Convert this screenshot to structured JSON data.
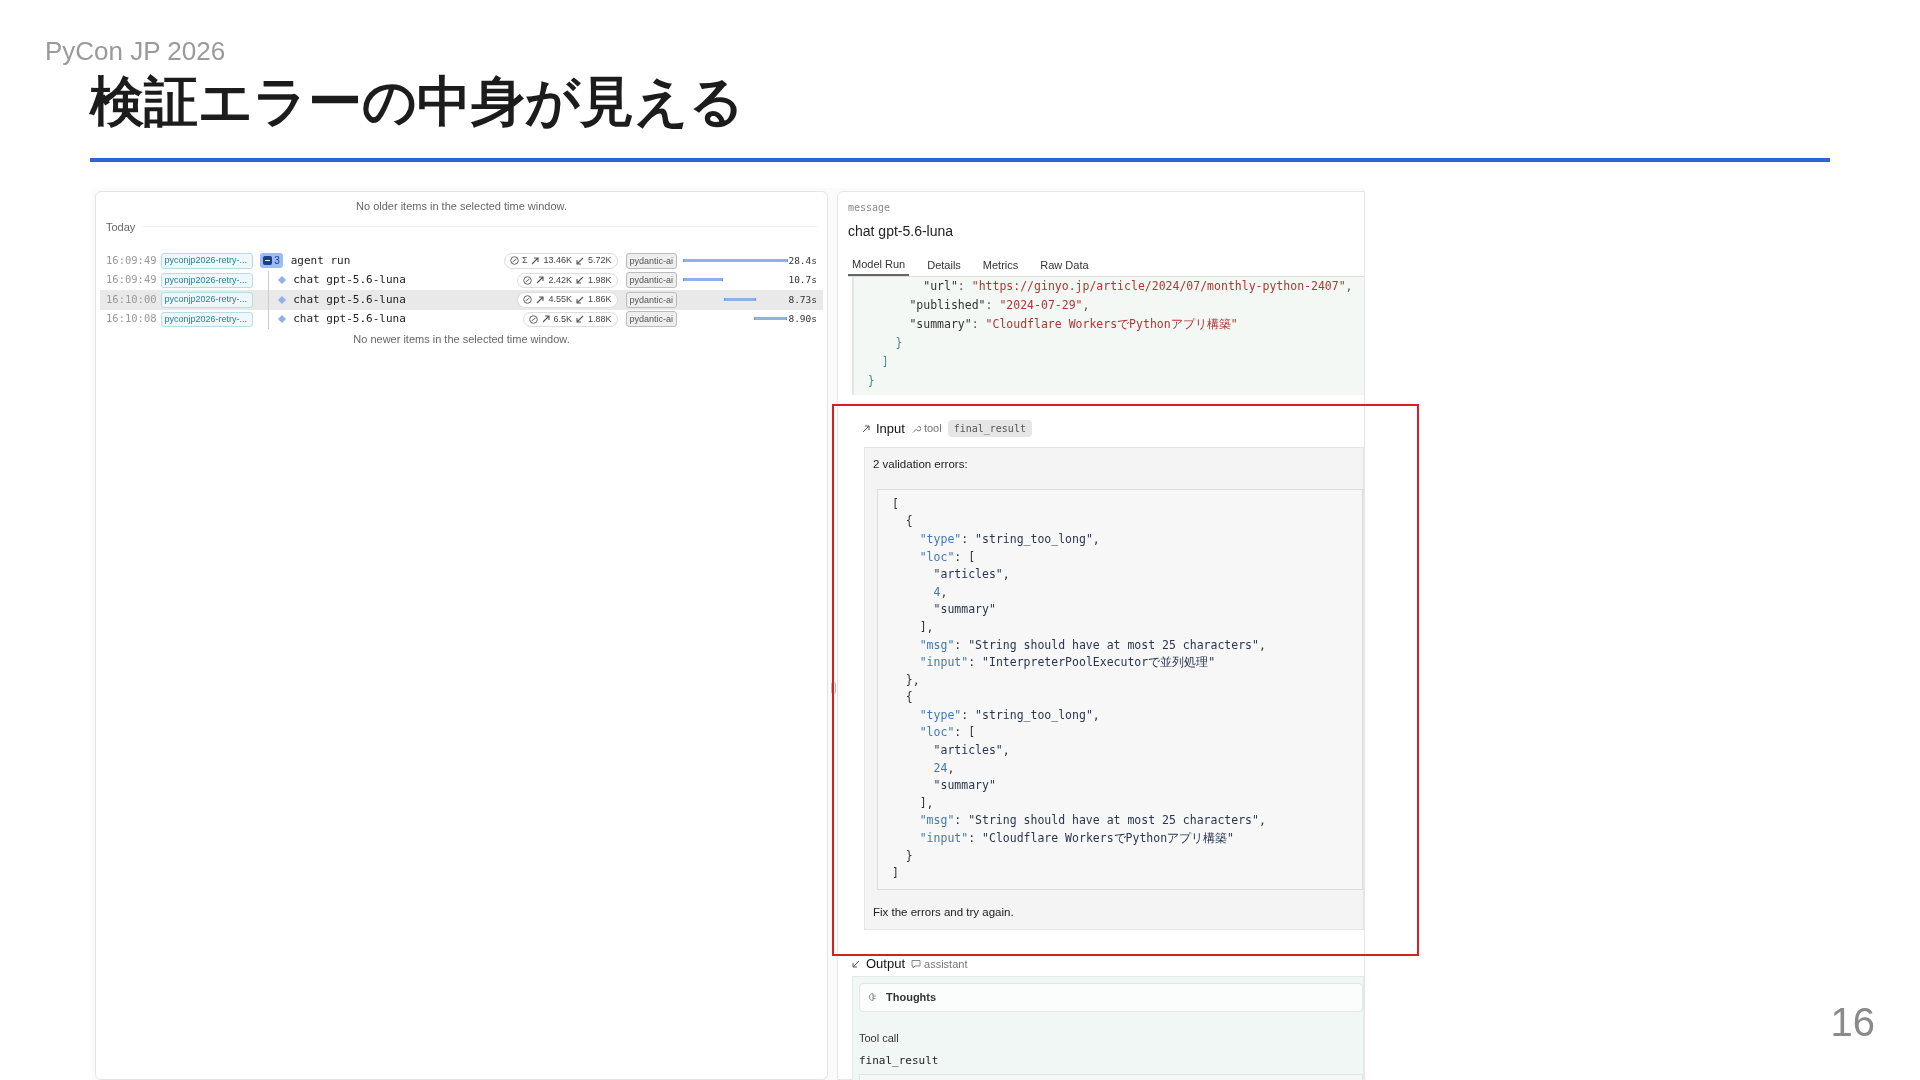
{
  "slide": {
    "conference": "PyCon JP 2026",
    "title": "検証エラーの中身が見える",
    "page_number": "16"
  },
  "trace_list": {
    "older_notice": "No older items in the selected time window.",
    "day_label": "Today",
    "rows": [
      {
        "time": "16:09:49",
        "tag": "pyconjp2026-retry-...",
        "expanded": true,
        "child_count": "3",
        "sum_symbol": "Σ",
        "name": "agent run",
        "tokens_in": "13.46K",
        "tokens_out": "5.72K",
        "service": "pydantic-ai",
        "duration": "28.4s",
        "selected": false,
        "children": [
          {
            "time": "16:09:49",
            "tag": "pyconjp2026-retry-...",
            "name": "chat gpt-5.6-luna",
            "tokens_in": "2.42K",
            "tokens_out": "1.98K",
            "service": "pydantic-ai",
            "duration": "10.7s",
            "selected": false
          },
          {
            "time": "16:10:00",
            "tag": "pyconjp2026-retry-...",
            "name": "chat gpt-5.6-luna",
            "tokens_in": "4.55K",
            "tokens_out": "1.86K",
            "service": "pydantic-ai",
            "duration": "8.73s",
            "selected": true
          },
          {
            "time": "16:10:08",
            "tag": "pyconjp2026-retry-...",
            "name": "chat gpt-5.6-luna",
            "tokens_in": "6.5K",
            "tokens_out": "1.88K",
            "service": "pydantic-ai",
            "duration": "8.90s",
            "selected": false
          }
        ]
      }
    ],
    "newer_notice": "No newer items in the selected time window."
  },
  "detail": {
    "label": "message",
    "title": "chat gpt-5.6-luna",
    "tabs": [
      {
        "label": "Model Run",
        "selected": true
      },
      {
        "label": "Details",
        "selected": false
      },
      {
        "label": "Metrics",
        "selected": false
      },
      {
        "label": "Raw Data",
        "selected": false
      }
    ],
    "previous_code": {
      "kind": "data",
      "lines": [
        [
          {
            "kind": "key",
            "text": "          \"url\""
          },
          {
            "kind": "punct",
            "text": ": "
          },
          {
            "kind": "string",
            "text": "\"https://ginyo.jp/article/2024/07/monthly-python-2407\""
          },
          {
            "kind": "punct",
            "text": ","
          }
        ],
        [
          {
            "kind": "key",
            "text": "        \"published\""
          },
          {
            "kind": "punct",
            "text": ": "
          },
          {
            "kind": "string",
            "text": "\"2024-07-29\""
          },
          {
            "kind": "punct",
            "text": ","
          }
        ],
        [
          {
            "kind": "key",
            "text": "        \"summary\""
          },
          {
            "kind": "punct",
            "text": ": "
          },
          {
            "kind": "string",
            "text": "\"Cloudflare WorkersでPythonアプリ構築\""
          }
        ],
        [
          {
            "kind": "bracket",
            "text": "      }"
          }
        ],
        [
          {
            "kind": "bracket",
            "text": "    ]"
          }
        ],
        [
          {
            "kind": "bracket",
            "text": "  }"
          }
        ]
      ]
    },
    "input": {
      "heading": "Input",
      "role": "tool",
      "tool_name": "final_result",
      "intro": "2 validation errors:",
      "code": {
        "kind": "error",
        "lines": [
          [
            {
              "kind": "punct",
              "text": "["
            }
          ],
          [
            {
              "kind": "punct",
              "text": "  {"
            }
          ],
          [
            {
              "kind": "key",
              "text": "    \"type\""
            },
            {
              "kind": "punct",
              "text": ": "
            },
            {
              "kind": "string",
              "text": "\"string_too_long\""
            },
            {
              "kind": "punct",
              "text": ","
            }
          ],
          [
            {
              "kind": "key",
              "text": "    \"loc\""
            },
            {
              "kind": "punct",
              "text": ": ["
            }
          ],
          [
            {
              "kind": "string",
              "text": "      \"articles\""
            },
            {
              "kind": "punct",
              "text": ","
            }
          ],
          [
            {
              "kind": "number",
              "text": "      4"
            },
            {
              "kind": "punct",
              "text": ","
            }
          ],
          [
            {
              "kind": "string",
              "text": "      \"summary\""
            }
          ],
          [
            {
              "kind": "punct",
              "text": "    ],"
            }
          ],
          [
            {
              "kind": "key",
              "text": "    \"msg\""
            },
            {
              "kind": "punct",
              "text": ": "
            },
            {
              "kind": "string",
              "text": "\"String should have at most 25 characters\""
            },
            {
              "kind": "punct",
              "text": ","
            }
          ],
          [
            {
              "kind": "key",
              "text": "    \"input\""
            },
            {
              "kind": "punct",
              "text": ": "
            },
            {
              "kind": "string",
              "text": "\"InterpreterPoolExecutorで並列処理\""
            }
          ],
          [
            {
              "kind": "punct",
              "text": "  },"
            }
          ],
          [
            {
              "kind": "punct",
              "text": "  {"
            }
          ],
          [
            {
              "kind": "key",
              "text": "    \"type\""
            },
            {
              "kind": "punct",
              "text": ": "
            },
            {
              "kind": "string",
              "text": "\"string_too_long\""
            },
            {
              "kind": "punct",
              "text": ","
            }
          ],
          [
            {
              "kind": "key",
              "text": "    \"loc\""
            },
            {
              "kind": "punct",
              "text": ": ["
            }
          ],
          [
            {
              "kind": "string",
              "text": "      \"articles\""
            },
            {
              "kind": "punct",
              "text": ","
            }
          ],
          [
            {
              "kind": "number",
              "text": "      24"
            },
            {
              "kind": "punct",
              "text": ","
            }
          ],
          [
            {
              "kind": "string",
              "text": "      \"summary\""
            }
          ],
          [
            {
              "kind": "punct",
              "text": "    ],"
            }
          ],
          [
            {
              "kind": "key",
              "text": "    \"msg\""
            },
            {
              "kind": "punct",
              "text": ": "
            },
            {
              "kind": "string",
              "text": "\"String should have at most 25 characters\""
            },
            {
              "kind": "punct",
              "text": ","
            }
          ],
          [
            {
              "kind": "key",
              "text": "    \"input\""
            },
            {
              "kind": "punct",
              "text": ": "
            },
            {
              "kind": "string",
              "text": "\"Cloudflare WorkersでPythonアプリ構築\""
            }
          ],
          [
            {
              "kind": "punct",
              "text": "  }"
            }
          ],
          [
            {
              "kind": "punct",
              "text": "]"
            }
          ]
        ]
      },
      "outro": "Fix the errors and try again."
    },
    "output": {
      "heading": "Output",
      "role": "assistant",
      "thoughts_label": "Thoughts",
      "tool_call_label": "Tool call",
      "tool_name": "final_result"
    }
  }
}
